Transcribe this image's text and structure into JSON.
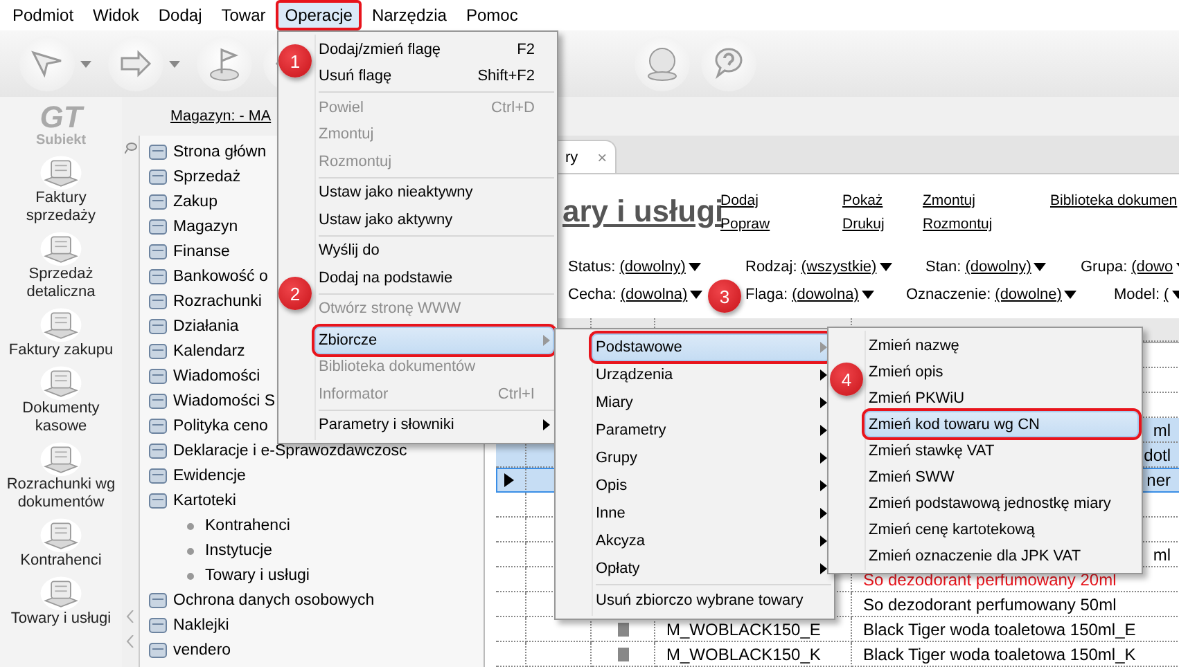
{
  "menubar": [
    {
      "label": "Podmiot",
      "selected": false
    },
    {
      "label": "Widok",
      "selected": false
    },
    {
      "label": "Dodaj",
      "selected": false
    },
    {
      "label": "Towar",
      "selected": false
    },
    {
      "label": "Operacje",
      "selected": true
    },
    {
      "label": "Narzędzia",
      "selected": false
    },
    {
      "label": "Pomoc",
      "selected": false
    }
  ],
  "sidebar": {
    "logo_mark": "GT",
    "logo": "Subiekt",
    "items": [
      "Faktury sprzedaży",
      "Sprzedaż detaliczna",
      "Faktury zakupu",
      "Dokumenty kasowe",
      "Rozrachunki wg dokumentów",
      "Kontrahenci",
      "Towary i usługi"
    ]
  },
  "location_link": "Magazyn: - MA",
  "nav_tree": [
    {
      "label": "Strona główn"
    },
    {
      "label": "Sprzedaż"
    },
    {
      "label": "Zakup"
    },
    {
      "label": "Magazyn"
    },
    {
      "label": "Finanse"
    },
    {
      "label": "Bankowość o"
    },
    {
      "label": "Rozrachunki"
    },
    {
      "label": "Działania"
    },
    {
      "label": "Kalendarz"
    },
    {
      "label": "Wiadomości"
    },
    {
      "label": "Wiadomości S"
    },
    {
      "label": "Polityka ceno"
    },
    {
      "label": "Deklaracje i e-Sprawozdawczosc"
    },
    {
      "label": "Ewidencje"
    },
    {
      "label": "Kartoteki",
      "children": [
        {
          "label": "Kontrahenci"
        },
        {
          "label": "Instytucje"
        },
        {
          "label": "Towary i usługi"
        }
      ]
    },
    {
      "label": "Ochrona danych osobowych"
    },
    {
      "label": "Naklejki"
    },
    {
      "label": "vendero"
    }
  ],
  "tab": {
    "label": "ry",
    "close": "×"
  },
  "heading": "ary i usługi",
  "actions": [
    [
      "Dodaj",
      "Popraw"
    ],
    [
      "Pokaż",
      "Drukuj"
    ],
    [
      "Zmontuj",
      "Rozmontuj"
    ],
    [
      "Biblioteka dokumen"
    ]
  ],
  "filters": [
    [
      {
        "label": "Status:",
        "value": "(dowolny)"
      },
      {
        "label": "Rodzaj:",
        "value": "(wszystkie)"
      },
      {
        "label": "Stan:",
        "value": "(dowolny)"
      },
      {
        "label": "Grupa:",
        "value": "(dowo"
      }
    ],
    [
      {
        "label": "Cecha:",
        "value": "(dowolna)"
      },
      {
        "label": "Flaga:",
        "value": "(dowolna)"
      },
      {
        "label": "Oznaczenie:",
        "value": "(dowolne)"
      },
      {
        "label": "Model:",
        "value": "("
      }
    ]
  ],
  "table": {
    "rows": [
      {
        "selected": false,
        "current": false
      },
      {
        "selected": false,
        "current": false
      },
      {
        "selected": false,
        "current": false
      },
      {
        "selected": true,
        "current": false,
        "color": "#000000",
        "name_end": "ml"
      },
      {
        "selected": true,
        "current": false,
        "color": "#000000",
        "name_end": "dotl"
      },
      {
        "selected": true,
        "current": true,
        "color": "#000000",
        "name_end": "ner"
      },
      {
        "selected": false,
        "current": false
      },
      {
        "selected": false,
        "current": false
      },
      {
        "selected": false,
        "current": false,
        "color": "#000000",
        "name_end": "ml"
      },
      {
        "selected": false,
        "current": false,
        "color": "#e8141c",
        "name": "So dezodorant perfumowany 20ml"
      },
      {
        "selected": false,
        "current": false,
        "color": "#000000",
        "name": "So dezodorant perfumowany 50ml"
      },
      {
        "selected": false,
        "current": false,
        "marked": true,
        "color": "#000000",
        "code": "M_WOBLACK150_E",
        "name": "Black Tiger woda toaletowa 150ml_E"
      },
      {
        "selected": false,
        "current": false,
        "marked": true,
        "color": "#000000",
        "code": "M_WOBLACK150_K",
        "name": "Black Tiger woda toaletowa 150ml_K"
      }
    ]
  },
  "menus": [
    {
      "groups": [
        [
          {
            "label": "Dodaj/zmień flagę",
            "shortcut": "F2",
            "disabled": false,
            "selected": false,
            "submenu": false
          },
          {
            "label": "Usuń flagę",
            "shortcut": "Shift+F2",
            "disabled": false,
            "selected": false,
            "submenu": false
          }
        ],
        [
          {
            "label": "Powiel",
            "shortcut": "Ctrl+D",
            "disabled": true,
            "selected": false,
            "submenu": false
          },
          {
            "label": "Zmontuj",
            "disabled": true,
            "selected": false,
            "submenu": false
          },
          {
            "label": "Rozmontuj",
            "disabled": true,
            "selected": false,
            "submenu": false
          }
        ],
        [
          {
            "label": "Ustaw jako nieaktywny",
            "disabled": false,
            "selected": false,
            "submenu": false
          },
          {
            "label": "Ustaw jako aktywny",
            "disabled": false,
            "selected": false,
            "submenu": false
          }
        ],
        [
          {
            "label": "Wyślij do",
            "disabled": false,
            "selected": false,
            "submenu": false
          },
          {
            "label": "Dodaj na podstawie",
            "disabled": false,
            "selected": false,
            "submenu": false
          }
        ],
        [
          {
            "label": "Otwórz stronę WWW",
            "disabled": true,
            "selected": false,
            "submenu": false
          }
        ],
        [
          {
            "label": "Zbiorcze",
            "disabled": false,
            "selected": true,
            "submenu": true
          },
          {
            "label": "Biblioteka dokumentów",
            "disabled": true,
            "selected": false,
            "submenu": false
          },
          {
            "label": "Informator",
            "shortcut": "Ctrl+I",
            "disabled": true,
            "selected": false,
            "submenu": false
          }
        ],
        [
          {
            "label": "Parametry i słowniki",
            "disabled": false,
            "selected": false,
            "submenu": true
          }
        ]
      ]
    },
    {
      "groups": [
        [
          {
            "label": "Podstawowe",
            "selected": true,
            "submenu": true
          },
          {
            "label": "Urządzenia",
            "selected": false,
            "submenu": true
          },
          {
            "label": "Miary",
            "selected": false,
            "submenu": true
          },
          {
            "label": "Parametry",
            "selected": false,
            "submenu": true
          },
          {
            "label": "Grupy",
            "selected": false,
            "submenu": true
          },
          {
            "label": "Opis",
            "selected": false,
            "submenu": true
          },
          {
            "label": "Inne",
            "selected": false,
            "submenu": true
          },
          {
            "label": "Akcyza",
            "selected": false,
            "submenu": true
          },
          {
            "label": "Opłaty",
            "selected": false,
            "submenu": true
          }
        ],
        [
          {
            "label": "Usuń zbiorczo wybrane towary",
            "selected": false,
            "submenu": false
          }
        ]
      ]
    },
    {
      "groups": [
        [
          {
            "label": "Zmień nazwę",
            "selected": false
          },
          {
            "label": "Zmień opis",
            "selected": false
          },
          {
            "label": "Zmień PKWiU",
            "selected": false
          },
          {
            "label": "Zmień kod towaru wg CN",
            "selected": true
          },
          {
            "label": "Zmień stawkę VAT",
            "selected": false
          },
          {
            "label": "Zmień SWW",
            "selected": false
          },
          {
            "label": "Zmień podstawową jednostkę miary",
            "selected": false
          },
          {
            "label": "Zmień cenę kartotekową",
            "selected": false
          },
          {
            "label": "Zmień oznaczenie dla JPK VAT",
            "selected": false
          }
        ]
      ]
    }
  ],
  "callouts": [
    "1",
    "2",
    "3",
    "4"
  ]
}
